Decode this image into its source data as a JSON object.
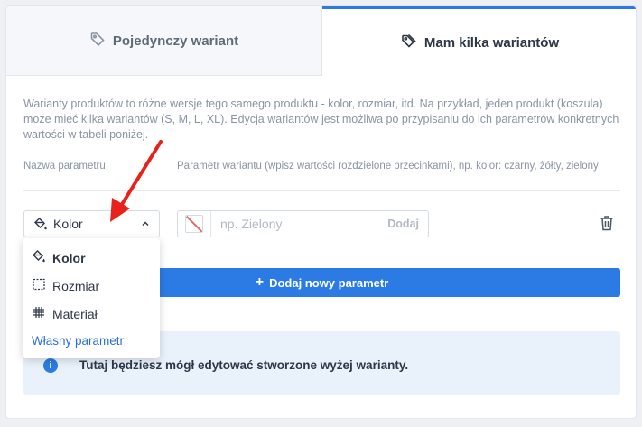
{
  "tabs": {
    "single": {
      "label": "Pojedynczy wariant",
      "icon": "tag-icon"
    },
    "multi": {
      "label": "Mam kilka wariantów",
      "icon": "tags-icon",
      "active": true
    }
  },
  "description": "Warianty produktów to różne wersje tego samego produktu - kolor, rozmiar, itd. Na przykład, jeden produkt (koszula) może mieć kilka wariantów (S, M, L, XL). Edycja wariantów jest możliwa po przypisaniu do ich parametrów konkretnych wartości w tabeli poniżej.",
  "columns": {
    "param_name": "Nazwa parametru",
    "param_values": "Parametr wariantu (wpisz wartości rozdzielone przecinkami), np. kolor: czarny, żółty, zielony"
  },
  "row": {
    "selected_param": "Kolor",
    "value_placeholder": "np. Zielony",
    "add_label": "Dodaj"
  },
  "dropdown": {
    "options": [
      {
        "label": "Kolor",
        "icon": "paint-bucket-icon"
      },
      {
        "label": "Rozmiar",
        "icon": "crop-size-icon"
      },
      {
        "label": "Materiał",
        "icon": "fabric-grid-icon"
      }
    ],
    "custom_label": "Własny parametr"
  },
  "add_param_button": "Dodaj nowy parametr",
  "info_text": "Tutaj będziesz mógł edytować stworzone wyżej warianty.",
  "colors": {
    "accent": "#2c7be5",
    "annotation_arrow": "#e8221b"
  }
}
